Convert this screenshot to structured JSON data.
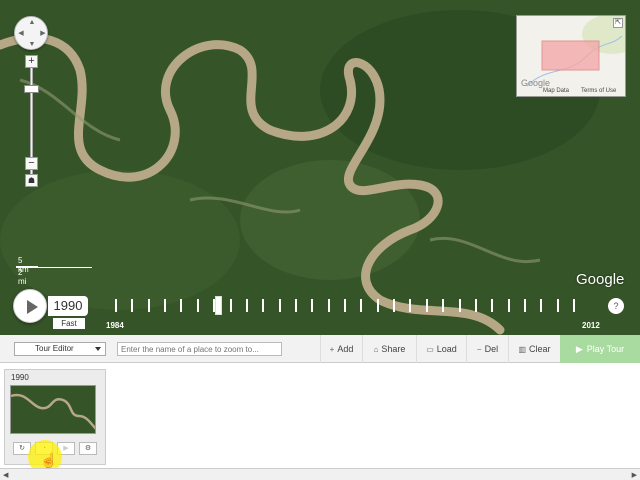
{
  "map": {
    "scale_km": "5 km",
    "scale_mi": "2 mi",
    "logo": "Google",
    "minimap_logo": "Google",
    "minimap_map_data": "Map Data",
    "minimap_terms": "Terms of Use",
    "colors": {
      "forest": "#3a5a2c",
      "river": "#b6a886"
    }
  },
  "timeline": {
    "current_year": "1990",
    "speed": "Fast",
    "start_year": "1984",
    "end_year": "2012",
    "help": "?",
    "progress_fraction": 0.22
  },
  "toolbar": {
    "editor_label": "Tour Editor",
    "place_placeholder": "Enter the name of a place to zoom to...",
    "add": "Add",
    "share": "Share",
    "load": "Load",
    "del": "Del",
    "clear": "Clear",
    "play_tour": "Play Tour"
  },
  "tour": {
    "cards": [
      {
        "year": "1990"
      }
    ]
  }
}
